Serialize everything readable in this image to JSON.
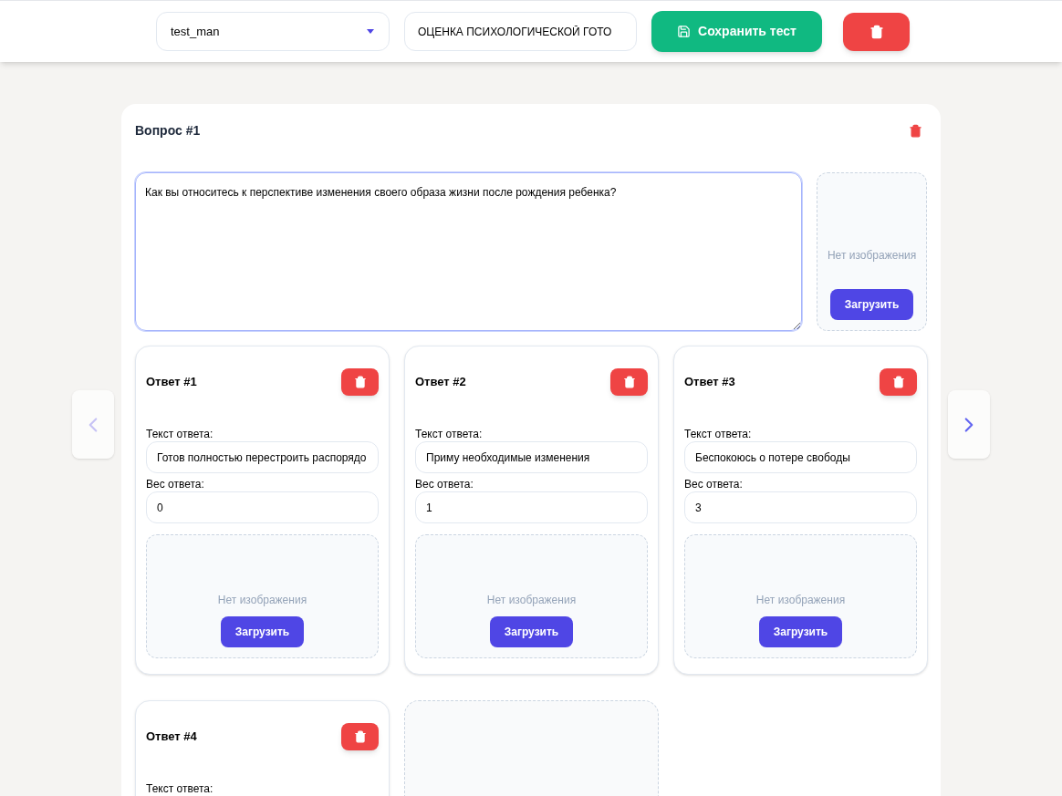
{
  "toolbar": {
    "test_select": {
      "value": "test_man"
    },
    "title_field": {
      "value": "ОЦЕНКА ПСИХОЛОГИЧЕСКОЙ ГОТО"
    },
    "save_button": {
      "label": "Сохранить тест"
    }
  },
  "question": {
    "title": "Вопрос #1",
    "text": "Как вы относитесь к перспективе изменения своего образа жизни после рождения ребенка?",
    "focused": true,
    "image": {
      "empty_text": "Нет изображения",
      "upload_label": "Загрузить"
    }
  },
  "answers": [
    {
      "title": "Ответ #1",
      "text_label": "Текст ответа:",
      "text": "Готов полностью перестроить распорядо",
      "weight_label": "Вес ответа:",
      "weight": "0",
      "image": {
        "empty_text": "Нет изображения",
        "upload_label": "Загрузить"
      }
    },
    {
      "title": "Ответ #2",
      "text_label": "Текст ответа:",
      "text": "Приму необходимые изменения",
      "weight_label": "Вес ответа:",
      "weight": "1",
      "image": {
        "empty_text": "Нет изображения",
        "upload_label": "Загрузить"
      }
    },
    {
      "title": "Ответ #3",
      "text_label": "Текст ответа:",
      "text": "Беспокоюсь о потере свободы",
      "weight_label": "Вес ответа:",
      "weight": "3",
      "image": {
        "empty_text": "Нет изображения",
        "upload_label": "Загрузить"
      }
    },
    {
      "title": "Ответ #4",
      "text_label": "Текст ответа:"
    }
  ],
  "empty_slot": true,
  "nav": {
    "prev_disabled": true,
    "next_disabled": false
  }
}
